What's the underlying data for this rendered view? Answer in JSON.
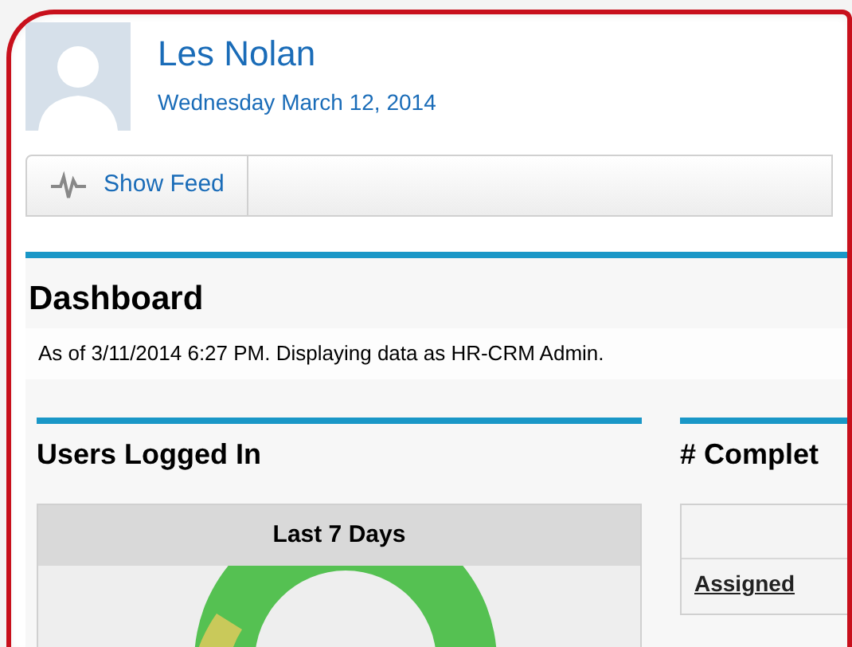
{
  "profile": {
    "name": "Les Nolan",
    "date": "Wednesday March 12, 2014"
  },
  "toolbar": {
    "show_feed": "Show Feed"
  },
  "dashboard": {
    "title": "Dashboard",
    "status": "As of 3/11/2014 6:27 PM. Displaying data as HR-CRM Admin.",
    "components": [
      {
        "kind": "chart",
        "title": "Users Logged In",
        "header": "Last 7 Days"
      },
      {
        "kind": "table",
        "title": "# Complet",
        "link": "Assigned"
      }
    ]
  }
}
